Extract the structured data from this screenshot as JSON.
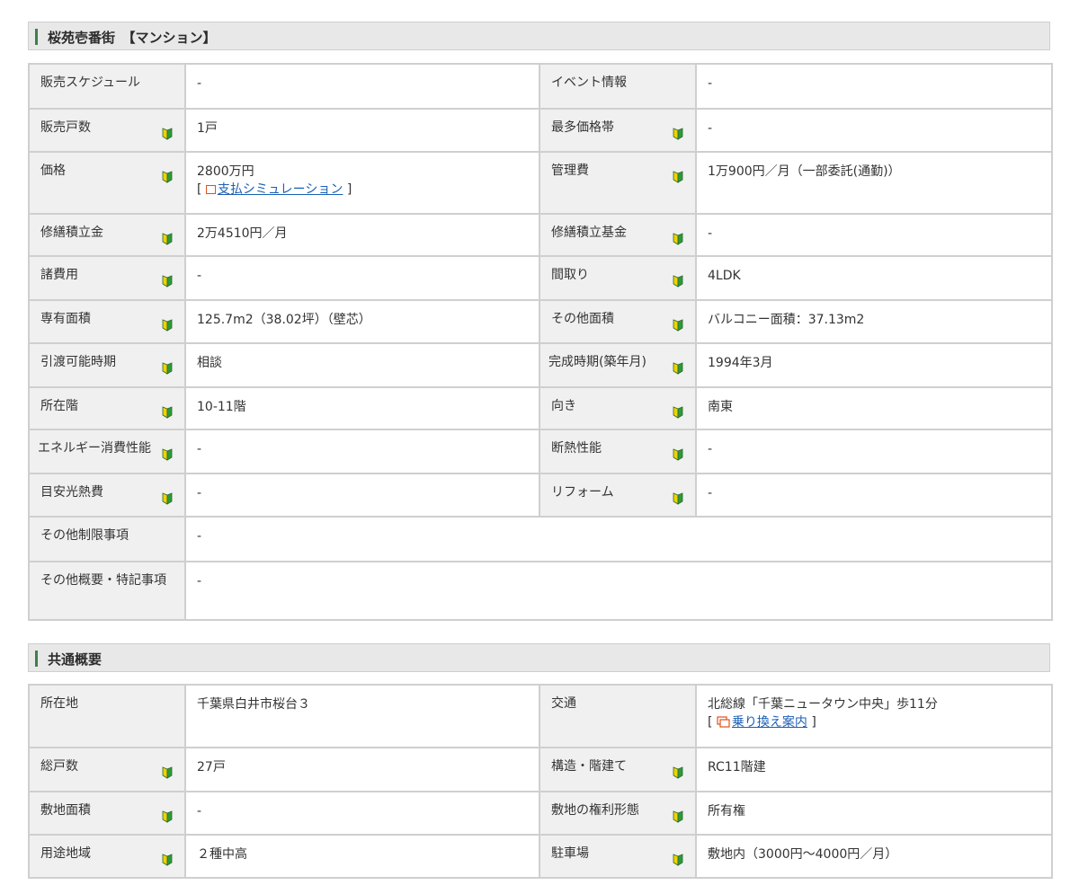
{
  "property": {
    "title": "桜苑壱番街　【マンション】",
    "rows": [
      [
        {
          "label": "販売スケジュール",
          "value": "-",
          "icon": false
        },
        {
          "label": "イベント情報",
          "value": "-",
          "icon": false
        }
      ],
      [
        {
          "label": "販売戸数",
          "value": "1戸",
          "icon": true
        },
        {
          "label": "最多価格帯",
          "value": "-",
          "icon": true
        }
      ],
      [
        {
          "label": "価格",
          "value": "2800万円",
          "icon": true,
          "link": "支払シミュレーション"
        },
        {
          "label": "管理費",
          "value": "1万900円／月（一部委託(通勤)）",
          "icon": true
        }
      ],
      [
        {
          "label": "修繕積立金",
          "value": "2万4510円／月",
          "icon": true
        },
        {
          "label": "修繕積立基金",
          "value": "-",
          "icon": true
        }
      ],
      [
        {
          "label": "諸費用",
          "value": "-",
          "icon": true
        },
        {
          "label": "間取り",
          "value": "4LDK",
          "icon": true
        }
      ],
      [
        {
          "label": "専有面積",
          "value": "125.7m2（38.02坪）（壁芯）",
          "icon": true
        },
        {
          "label": "その他面積",
          "value": "バルコニー面積：37.13m2",
          "icon": true
        }
      ],
      [
        {
          "label": "引渡可能時期",
          "value": "相談",
          "icon": true
        },
        {
          "label": "完成時期(築年月)",
          "value": "1994年3月",
          "icon": true
        }
      ],
      [
        {
          "label": "所在階",
          "value": "10-11階",
          "icon": true
        },
        {
          "label": "向き",
          "value": "南東",
          "icon": true
        }
      ],
      [
        {
          "label": "エネルギー消費性能",
          "value": "-",
          "icon": true
        },
        {
          "label": "断熱性能",
          "value": "-",
          "icon": true
        }
      ],
      [
        {
          "label": "目安光熱費",
          "value": "-",
          "icon": true
        },
        {
          "label": "リフォーム",
          "value": "-",
          "icon": true
        }
      ]
    ],
    "restrictions": {
      "label": "その他制限事項",
      "value": "-"
    },
    "notes": {
      "label": "その他概要・特記事項",
      "value": "-"
    }
  },
  "common": {
    "title": "共通概要",
    "rows": [
      [
        {
          "label": "所在地",
          "value": "千葉県白井市桜台３",
          "icon": false
        },
        {
          "label": "交通",
          "value": "北総線「千葉ニュータウン中央」歩11分",
          "icon": false,
          "link": "乗り換え案内"
        }
      ],
      [
        {
          "label": "総戸数",
          "value": "27戸",
          "icon": true
        },
        {
          "label": "構造・階建て",
          "value": "RC11階建",
          "icon": true
        }
      ],
      [
        {
          "label": "敷地面積",
          "value": "-",
          "icon": true
        },
        {
          "label": "敷地の権利形態",
          "value": "所有権",
          "icon": true
        }
      ],
      [
        {
          "label": "用途地域",
          "value": "２種中高",
          "icon": true
        },
        {
          "label": "駐車場",
          "value": "敷地内（3000円～4000円／月）",
          "icon": true
        }
      ]
    ]
  },
  "brackets": {
    "open": "[ ",
    "close": " ]"
  },
  "colors": {
    "header_bg": "#e8e8e8",
    "accent": "#3f7f4a",
    "link": "#1a5fb4",
    "label_bg": "#f0f0f0"
  }
}
